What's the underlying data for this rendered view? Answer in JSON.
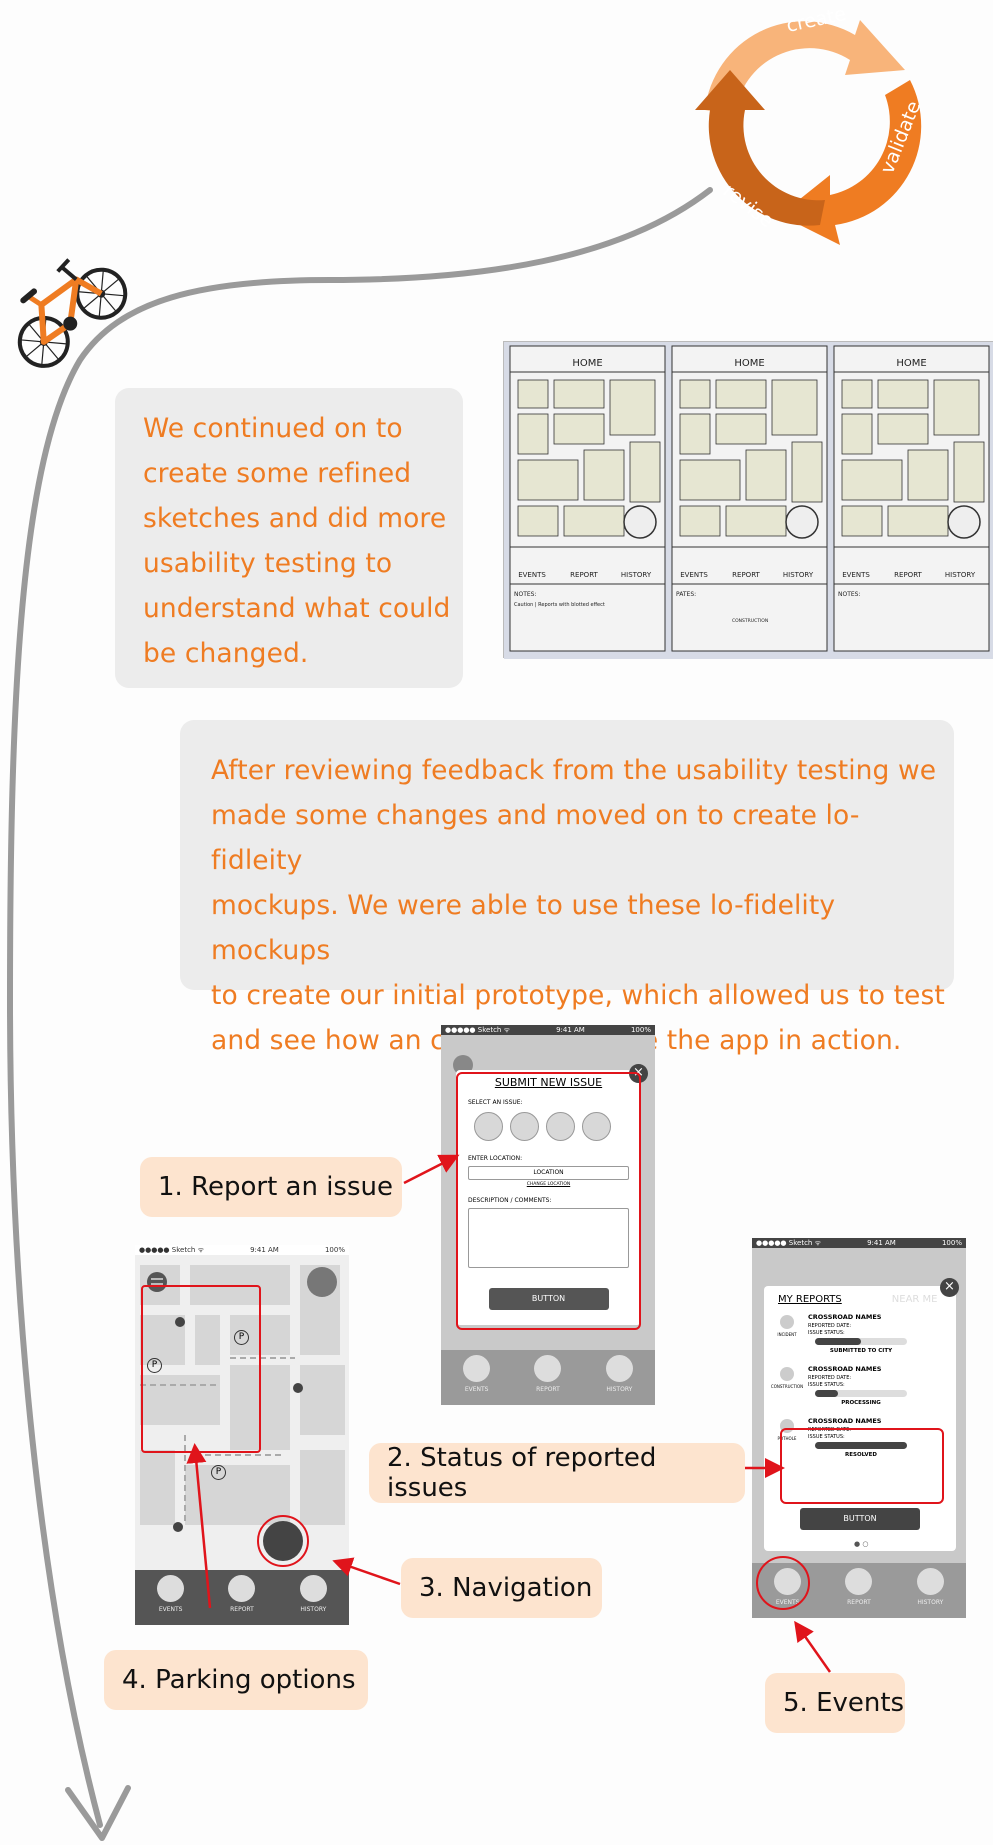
{
  "cycle": {
    "labels": [
      "create",
      "validate",
      "revise"
    ],
    "colors": {
      "light": "#f8b47a",
      "mid": "#ef7c22",
      "dark": "#c8641a"
    }
  },
  "intro_card": {
    "lines": [
      "We continued on to",
      "create some refined",
      "sketches and did more",
      "usability testing to",
      "understand what could",
      "be changed."
    ]
  },
  "feedback_card": {
    "lines": [
      "After reviewing feedback from the usability testing we",
      "made some changes and moved on to create lo- fidleity",
      "mockups. We were able to use these lo-fidelity mockups",
      "to create our initial prototype, which allowed us to test",
      "and see how an cyclist would use the app in action."
    ]
  },
  "sketches": {
    "panels": [
      {
        "title": "HOME",
        "nav": [
          "EVENTS",
          "REPORT",
          "HISTORY"
        ],
        "notes": "NOTES:",
        "note_text": "Caution | Reports with blotted effect",
        "extra": ""
      },
      {
        "title": "HOME",
        "nav": [
          "EVENTS",
          "REPORT",
          "HISTORY"
        ],
        "notes": "PATES:",
        "note_text": "",
        "extra": "CONSTRUCTION"
      },
      {
        "title": "HOME",
        "nav": [
          "EVENTS",
          "REPORT",
          "HISTORY"
        ],
        "notes": "NOTES:",
        "note_text": "",
        "extra": ""
      }
    ]
  },
  "mock_report": {
    "status_bar": {
      "carrier": "●●●●● Sketch ᯤ",
      "time": "9:41 AM",
      "battery": "100%"
    },
    "title": "SUBMIT NEW ISSUE",
    "select_label": "SELECT AN ISSUE:",
    "location_label": "ENTER LOCATION:",
    "location_value": "LOCATION",
    "change_location": "CHANGE LOCATION",
    "description_label": "DESCRIPTION / COMMENTS:",
    "button": "BUTTON",
    "nav": [
      "EVENTS",
      "REPORT",
      "HISTORY"
    ]
  },
  "mock_map": {
    "status_bar": {
      "carrier": "●●●●● Sketch ᯤ",
      "time": "9:41 AM",
      "battery": "100%"
    },
    "parking": "P",
    "nav": [
      "EVENTS",
      "REPORT",
      "HISTORY"
    ]
  },
  "mock_reports": {
    "status_bar": {
      "carrier": "●●●●● Sketch ᯤ",
      "time": "9:41 AM",
      "battery": "100%"
    },
    "tab_active": "MY REPORTS",
    "tab_inactive": "NEAR ME",
    "items": [
      {
        "icon_label": "INCIDENT",
        "name": "CROSSROAD NAMES",
        "date": "REPORTED DATE:",
        "status_label": "ISSUE STATUS:",
        "status": "SUBMITTED TO  CITY",
        "progress": 0.5
      },
      {
        "icon_label": "CONSTRUCTION",
        "name": "CROSSROAD NAMES",
        "date": "REPORTED DATE:",
        "status_label": "ISSUE STATUS:",
        "status": "PROCESSING",
        "progress": 0.25
      },
      {
        "icon_label": "POTHOLE",
        "name": "CROSSROAD NAMES",
        "date": "REPORTED DATE:",
        "status_label": "ISSUE STATUS:",
        "status": "RESOLVED",
        "progress": 1.0
      }
    ],
    "button": "BUTTON",
    "nav": [
      "EVENTS",
      "REPORT",
      "HISTORY"
    ]
  },
  "callouts": {
    "report": "1. Report an issue",
    "status": "2. Status of reported issues",
    "navigation": "3. Navigation",
    "parking": "4. Parking options",
    "events": "5. Events"
  }
}
